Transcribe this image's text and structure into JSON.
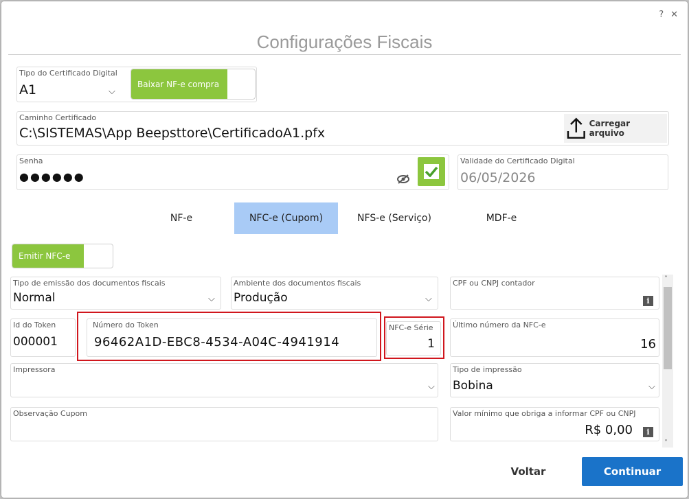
{
  "window": {
    "help": "?",
    "close": "✕"
  },
  "title": "Configurações Fiscais",
  "certificado": {
    "tipo_label": "Tipo do Certificado Digital",
    "tipo_value": "A1",
    "baixar_label": "Baixar NF-e compra",
    "baixar_on": true,
    "caminho_label": "Caminho Certificado",
    "caminho_value": "C:\\SISTEMAS\\App Beepsttore\\CertificadoA1.pfx",
    "carregar_label": "Carregar arquivo",
    "senha_label": "Senha",
    "senha_value": "●●●●●●",
    "validade_label": "Validade do Certificado Digital",
    "validade_value": "06/05/2026"
  },
  "tabs": [
    {
      "label": "NF-e",
      "active": false
    },
    {
      "label": "NFC-e (Cupom)",
      "active": true
    },
    {
      "label": "NFS-e (Serviço)",
      "active": false
    },
    {
      "label": "MDF-e",
      "active": false
    }
  ],
  "nfce": {
    "emitir_label": "Emitir NFC-e",
    "emitir_on": true,
    "tipo_emissao_label": "Tipo de emissão dos documentos fiscais",
    "tipo_emissao_value": "Normal",
    "ambiente_label": "Ambiente dos documentos fiscais",
    "ambiente_value": "Produção",
    "cpf_contador_label": "CPF ou CNPJ contador",
    "cpf_contador_value": "",
    "id_token_label": "Id do Token",
    "id_token_value": "000001",
    "numero_token_label": "Número do Token",
    "numero_token_value": "96462A1D-EBC8-4534-A04C-4941914",
    "serie_label": "NFC-e Série",
    "serie_value": "1",
    "ultimo_numero_label": "Último número da NFC-e",
    "ultimo_numero_value": "16",
    "impressora_label": "Impressora",
    "impressora_value": "",
    "tipo_impressao_label": "Tipo de impressão",
    "tipo_impressao_value": "Bobina",
    "observacao_label": "Observação Cupom",
    "observacao_value": "",
    "valor_minimo_label": "Valor mínimo que obriga a informar CPF ou CNPJ",
    "valor_minimo_value": "R$ 0,00"
  },
  "footer": {
    "voltar": "Voltar",
    "continuar": "Continuar"
  },
  "colors": {
    "accent_green": "#8cc63e",
    "tab_active": "#a9cbf6",
    "primary_blue": "#1a73c9",
    "highlight_red": "#d0161d"
  }
}
